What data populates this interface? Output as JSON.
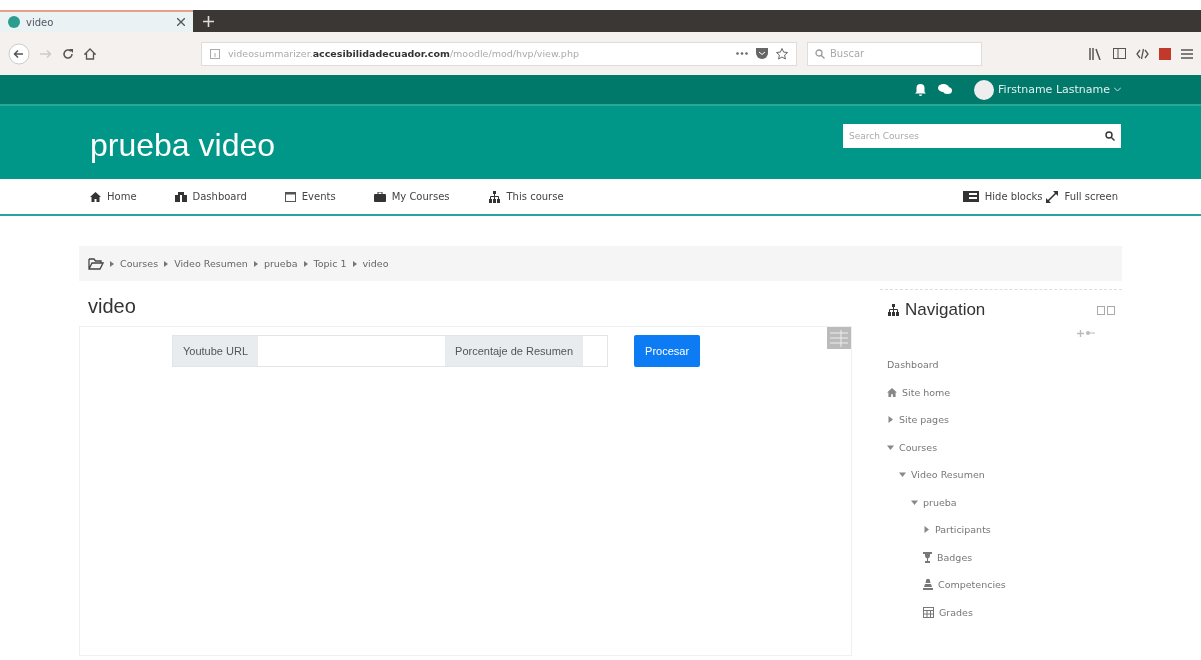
{
  "browser": {
    "tab": {
      "title": "video"
    },
    "url": {
      "prefix": "videosummarizer.",
      "domain": "accesibilidadecuador.com",
      "path": "/moodle/mod/hvp/view.php"
    },
    "search": {
      "placeholder": "Buscar"
    }
  },
  "topbar": {
    "user": "Firstname Lastname"
  },
  "header": {
    "title": "prueba video",
    "search": {
      "placeholder": "Search Courses"
    }
  },
  "nav": {
    "items": [
      "Home",
      "Dashboard",
      "Events",
      "My Courses",
      "This course"
    ],
    "right": [
      "Hide blocks",
      "Full screen"
    ]
  },
  "breadcrumb": [
    "Courses",
    "Video Resumen",
    "prueba",
    "Topic 1",
    "video"
  ],
  "page": {
    "title": "video",
    "form": {
      "url_label": "Youtube URL",
      "percent_label": "Porcentaje de Resumen",
      "button": "Procesar"
    }
  },
  "navigation": {
    "title": "Navigation",
    "tree": [
      {
        "label": "Dashboard",
        "kind": "plain"
      },
      {
        "label": "Site home",
        "kind": "home"
      },
      {
        "label": "Site pages",
        "kind": "branch",
        "expanded": false
      },
      {
        "label": "Courses",
        "kind": "branch",
        "expanded": true,
        "children": [
          {
            "label": "Video Resumen",
            "kind": "branch",
            "expanded": true,
            "children": [
              {
                "label": "prueba",
                "kind": "branch",
                "expanded": true,
                "children": [
                  {
                    "label": "Participants",
                    "kind": "branch",
                    "expanded": false
                  },
                  {
                    "label": "Badges",
                    "kind": "badge"
                  },
                  {
                    "label": "Competencies",
                    "kind": "competency"
                  },
                  {
                    "label": "Grades",
                    "kind": "grades"
                  }
                ]
              }
            ]
          }
        ]
      }
    ]
  }
}
